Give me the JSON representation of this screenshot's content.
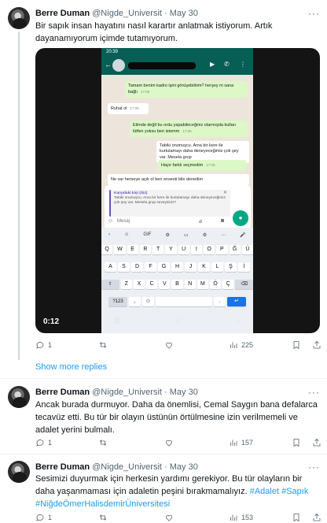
{
  "tweets": [
    {
      "name": "Berre Duman",
      "handle": "@Nigde_Universit",
      "dot": "·",
      "date": "May 30",
      "text": "Bir sapık insan hayatını nasıl karartır anlatmak istiyorum. Artık dayanamıyorum içimde tutamıyorum.",
      "replies": "1",
      "retweets": "",
      "likes": "",
      "views": "225"
    },
    {
      "name": "Berre Duman",
      "handle": "@Nigde_Universit",
      "dot": "·",
      "date": "May 30",
      "text": "Ancak burada durmuyor. Daha da önemlisi, Cemal Saygın bana defalarca tecavüz etti. Bu tür bir olayın üstünün örtülmesine izin verilmemeli ve adalet yerini bulmalı.",
      "replies": "1",
      "retweets": "",
      "likes": "",
      "views": "157"
    },
    {
      "name": "Berre Duman",
      "handle": "@Nigde_Universit",
      "dot": "·",
      "date": "May 30",
      "text": "Sesimizi duyurmak için herkesin yardımı gerekiyor. Bu tür olayların bir daha yaşanmaması için adaletin peşini bırakmamalıyız.",
      "hashtags": [
        "#Adalet",
        "#Sapık",
        "#NiğdeÖmerHalisdemirÜniversitesi"
      ],
      "replies": "1",
      "retweets": "",
      "likes": "",
      "views": "153"
    }
  ],
  "show_more_replies": "Show more replies",
  "video": {
    "duration": "0:12",
    "phone_time": "20:39",
    "chat": [
      {
        "dir": "out",
        "text": "Tamam benim kadro işini görüşebilirim? herşey m sana bağlı",
        "time": "17:05"
      },
      {
        "dir": "in",
        "text": "Ruhat ol",
        "time": "17:05"
      },
      {
        "dir": "out",
        "text": "Elimde değil bu ordu yapabileceğiniz olarmışda kulları lütfen yoksu ben istemm",
        "time": "17:08"
      },
      {
        "dir": "in",
        "text": "Tabiki orumuşcu. Ama bir kere ile kurtulamayı daha deneyeceğimiz çok şey var. Mesela grup",
        "time": ""
      },
      {
        "dir": "out",
        "text": "Hayır farklı seçmedim",
        "time": "17:09"
      },
      {
        "dir": "in",
        "text": "Ne var herseye açık ol ben ensesti bile denedim",
        "time": ""
      }
    ],
    "quote_author": "Karşıdaki kişi (Siz)",
    "quote_text": "Tabiki orumuşcu. Ama bir kere ile kurtulamayı daha deneyeceğimiz çok şey var. Mesela grup seveysiniz?",
    "message_placeholder": "Mesaj",
    "kbd_top": [
      "‹",
      "☺",
      "GIF",
      "⚙",
      "▭",
      "⚙",
      "⋯",
      "🎤"
    ],
    "rows": [
      [
        "Q",
        "W",
        "E",
        "R",
        "T",
        "Y",
        "U",
        "I",
        "O",
        "P",
        "Ğ",
        "Ü"
      ],
      [
        "A",
        "S",
        "D",
        "F",
        "G",
        "H",
        "J",
        "K",
        "L",
        "Ş",
        "İ"
      ],
      [
        "⇧",
        "Z",
        "X",
        "C",
        "V",
        "B",
        "N",
        "M",
        "Ö",
        "Ç",
        "⌫"
      ],
      [
        "?123",
        ",",
        "☺",
        "",
        "",
        "",
        ".",
        "↵"
      ]
    ]
  },
  "colors": {
    "link": "#1d9bf0",
    "muted": "#536471",
    "whatsapp_green": "#075e54"
  }
}
